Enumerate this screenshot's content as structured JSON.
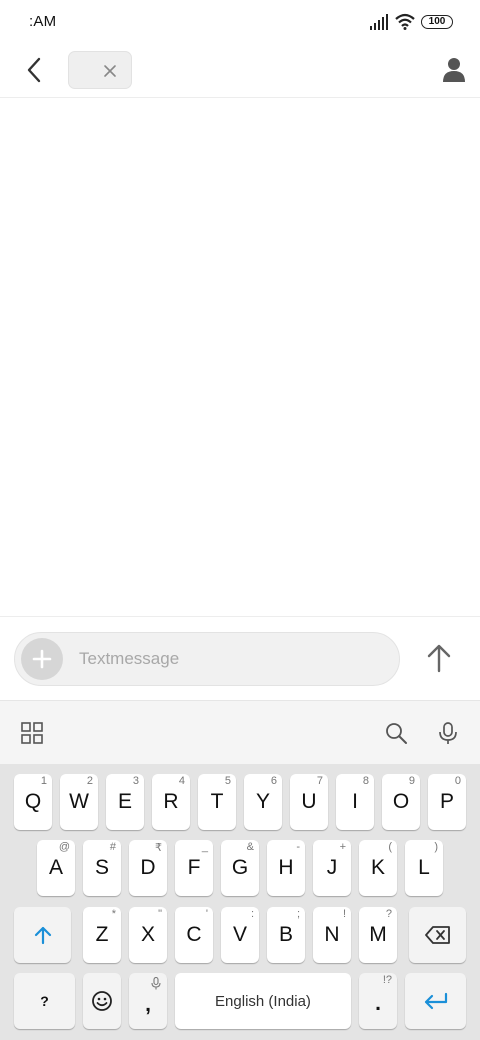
{
  "status_bar": {
    "time": ":AM",
    "battery": "100"
  },
  "composer": {
    "placeholder": "Textmessage"
  },
  "keyboard": {
    "row1": [
      {
        "key": "Q",
        "hint": "1"
      },
      {
        "key": "W",
        "hint": "2"
      },
      {
        "key": "E",
        "hint": "3"
      },
      {
        "key": "R",
        "hint": "4"
      },
      {
        "key": "T",
        "hint": "5"
      },
      {
        "key": "Y",
        "hint": "6"
      },
      {
        "key": "U",
        "hint": "7"
      },
      {
        "key": "I",
        "hint": "8"
      },
      {
        "key": "O",
        "hint": "9"
      },
      {
        "key": "P",
        "hint": "0"
      }
    ],
    "row2": [
      {
        "key": "A",
        "hint": "@"
      },
      {
        "key": "S",
        "hint": "#"
      },
      {
        "key": "D",
        "hint": "₹"
      },
      {
        "key": "F",
        "hint": "_"
      },
      {
        "key": "G",
        "hint": "&"
      },
      {
        "key": "H",
        "hint": "-"
      },
      {
        "key": "J",
        "hint": "+"
      },
      {
        "key": "K",
        "hint": "("
      },
      {
        "key": "L",
        "hint": ")"
      }
    ],
    "row3": [
      {
        "key": "Z",
        "hint": "*"
      },
      {
        "key": "X",
        "hint": "\""
      },
      {
        "key": "C",
        "hint": "'"
      },
      {
        "key": "V",
        "hint": ":"
      },
      {
        "key": "B",
        "hint": ";"
      },
      {
        "key": "N",
        "hint": "!"
      },
      {
        "key": "M",
        "hint": "?"
      }
    ],
    "symbols_key": "?",
    "comma_key": ",",
    "period_key": ".",
    "period_hint": "!?",
    "space_label": "English (India)"
  },
  "icons": {
    "status": [
      "signal-icon",
      "wifi-icon",
      "battery-icon"
    ],
    "header": [
      "back-arrow-icon",
      "close-icon",
      "person-icon"
    ],
    "composer": [
      "plus-icon",
      "send-arrow-icon"
    ],
    "toolbar": [
      "grid-icon",
      "search-icon",
      "microphone-icon"
    ],
    "keyboard": [
      "shift-arrow-icon",
      "backspace-icon",
      "emoji-icon",
      "microphone-small-icon",
      "enter-icon"
    ]
  },
  "colors": {
    "accent": "#1a8fd8",
    "chip": "#efefef",
    "keyboard_bg": "#e4e4e4"
  }
}
